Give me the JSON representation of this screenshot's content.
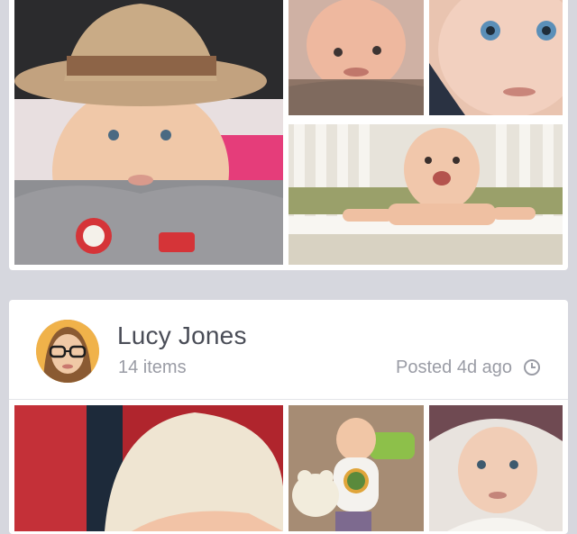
{
  "feed": {
    "post2": {
      "author_name": "Lucy Jones",
      "item_count": "14 items",
      "posted_time": "Posted 4d ago"
    }
  },
  "colors": {
    "background": "#d6d7de",
    "card": "#ffffff",
    "name_text": "#4a4d57",
    "meta_text": "#9a9ca5"
  },
  "icons": {
    "clock": "clock-icon"
  }
}
